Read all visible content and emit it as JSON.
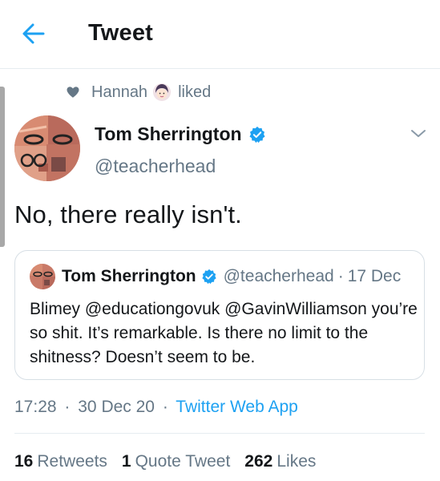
{
  "header": {
    "title": "Tweet",
    "back_icon": "arrow-left-icon",
    "accent_color": "#1da1f2"
  },
  "social_context": {
    "icon": "heart-icon",
    "user": "Hannah",
    "user_emoji": "woman-face-emoji",
    "action": "liked"
  },
  "tweet": {
    "author_name": "Tom Sherrington",
    "author_handle": "@teacherhead",
    "verified_icon": "verified-badge-icon",
    "menu_icon": "chevron-down-icon",
    "text": "No, there really isn't.",
    "time": "17:28",
    "date": "30 Dec 20",
    "source": "Twitter Web App",
    "separator": "·"
  },
  "quoted_tweet": {
    "author_name": "Tom Sherrington",
    "author_handle": "@teacherhead",
    "date": "17 Dec",
    "separator": "·",
    "text": "Blimey @educationgovuk @GavinWilliamson you’re so shit. It’s remarkable. Is there no limit to the shitness? Doesn’t seem to be."
  },
  "stats": {
    "retweets_count": "16",
    "retweets_label": "Retweets",
    "quote_count": "1",
    "quote_label": "Quote Tweet",
    "likes_count": "262",
    "likes_label": "Likes"
  },
  "colors": {
    "text_primary": "#14171a",
    "text_secondary": "#657786",
    "link": "#1da1f2",
    "border": "#e6ecf0"
  }
}
